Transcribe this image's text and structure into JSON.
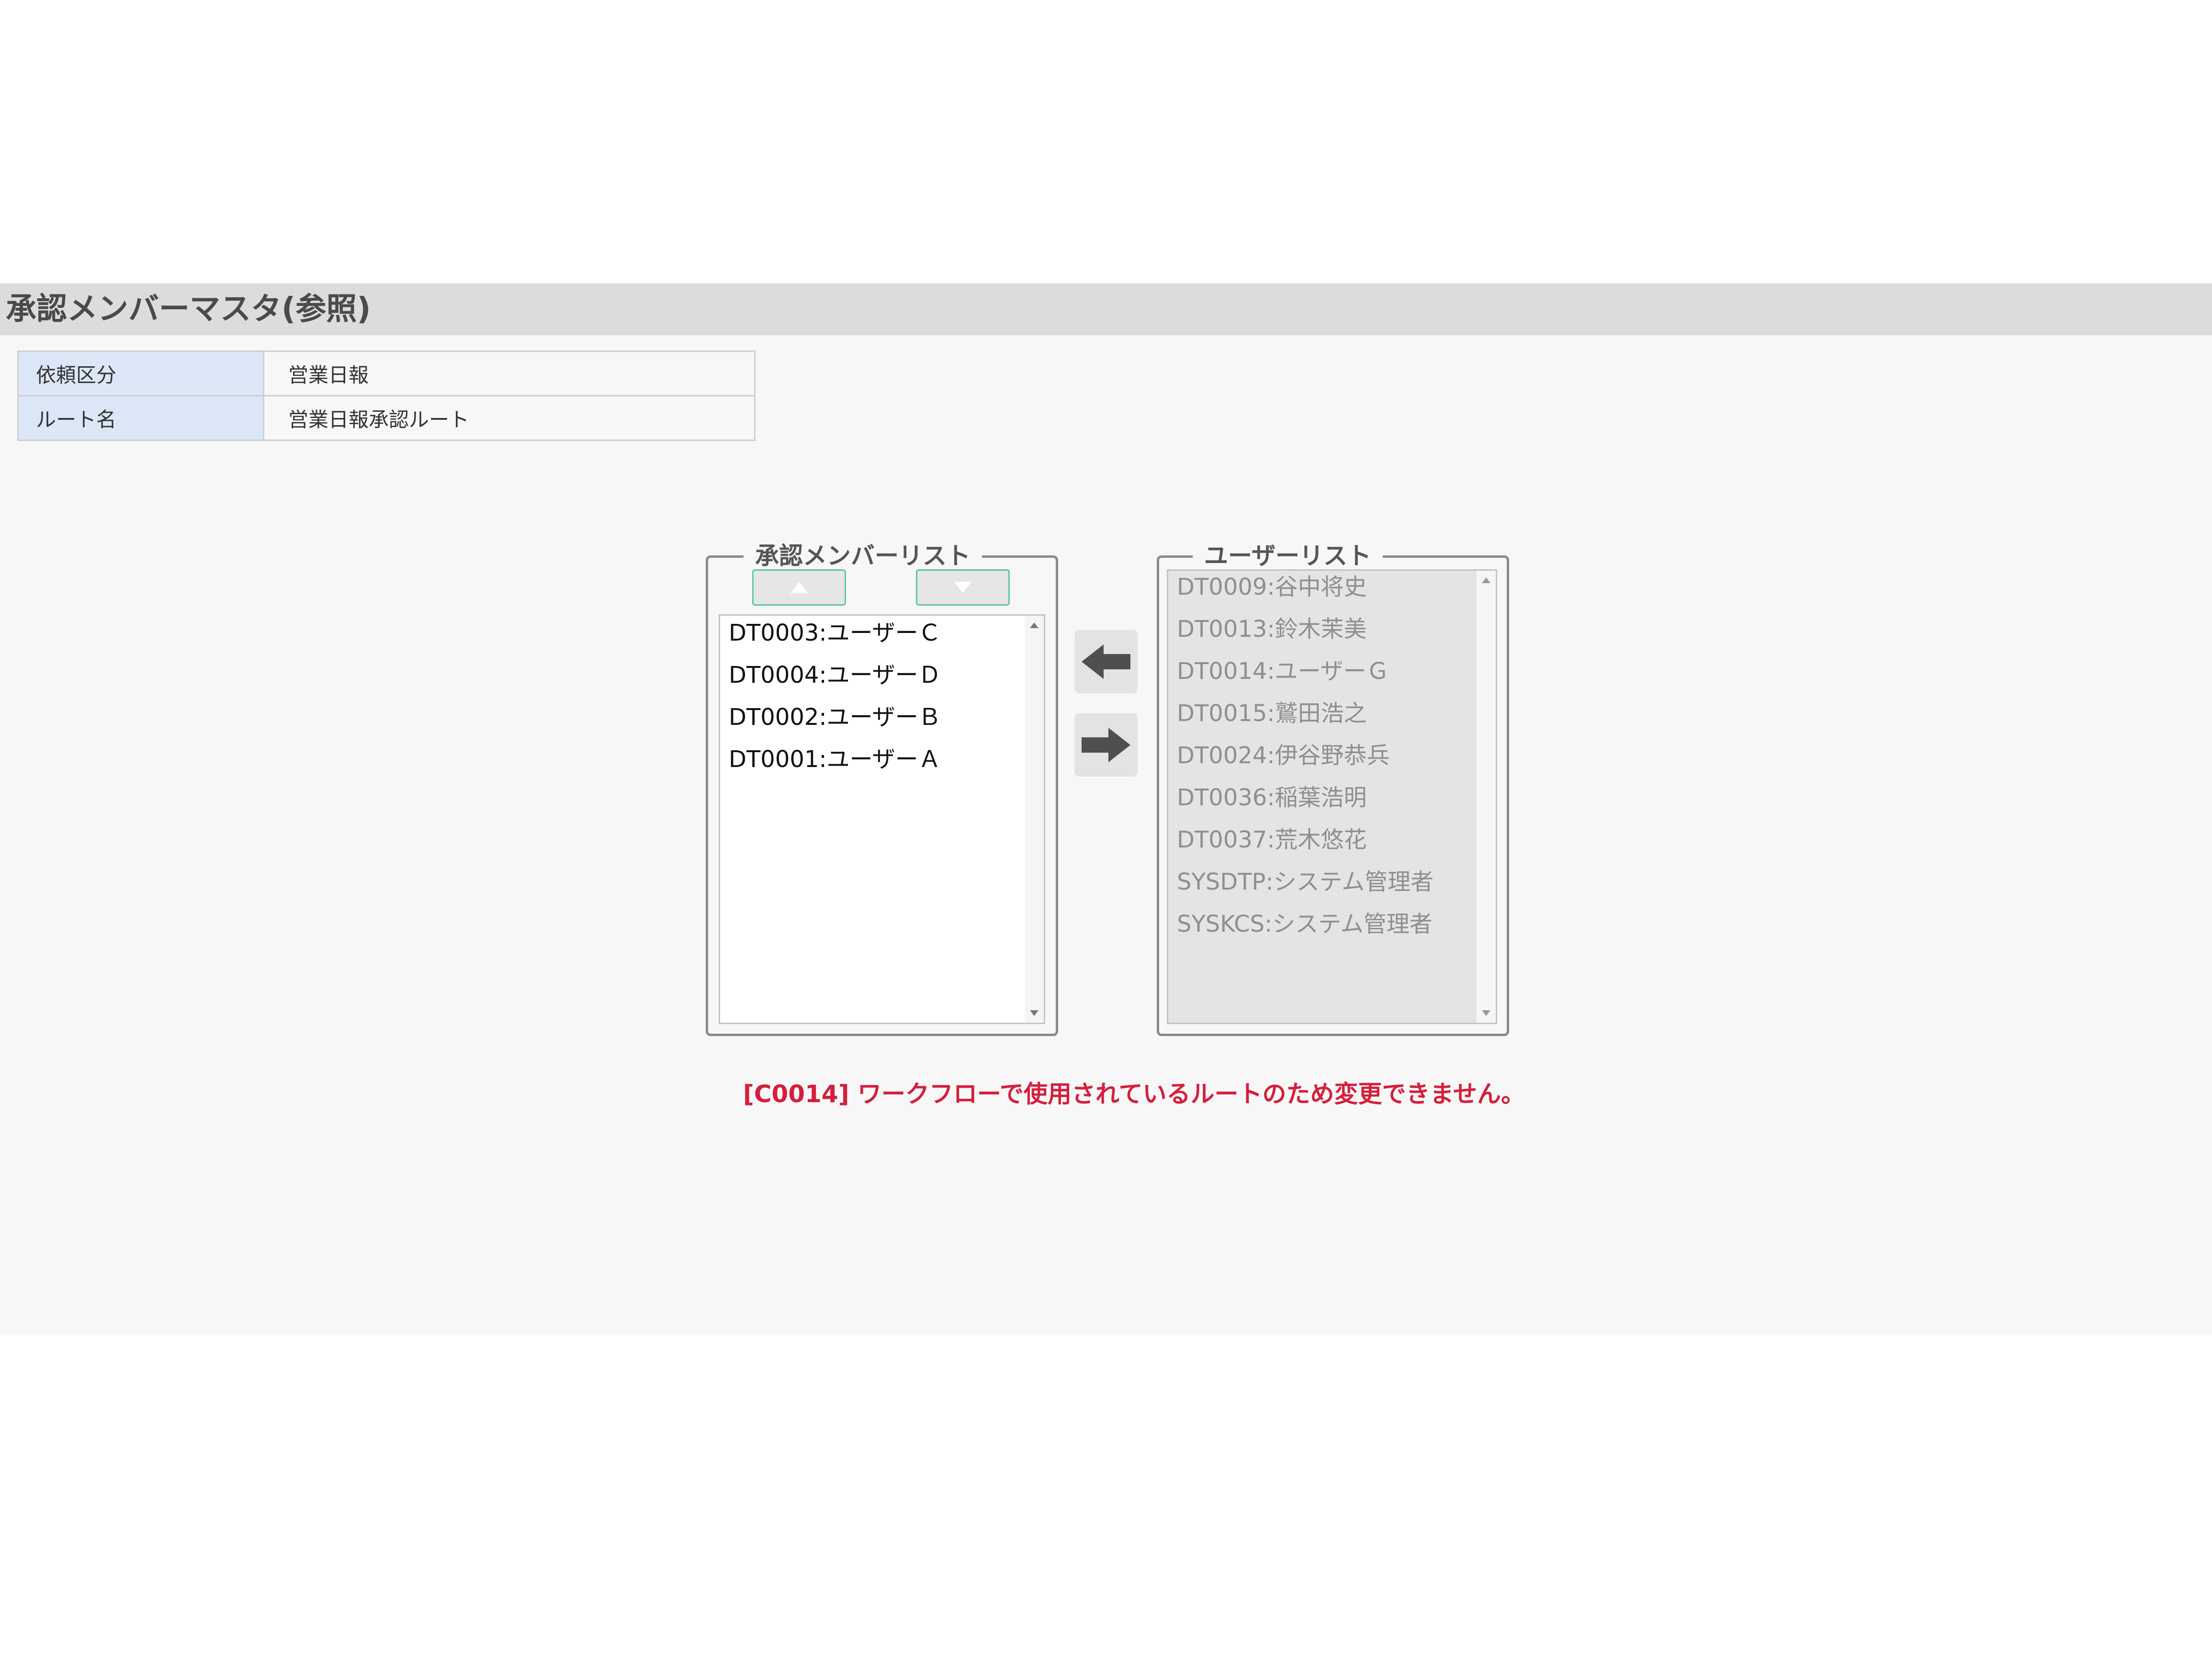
{
  "page_title": "承認メンバーマスタ(参照)",
  "info_table": {
    "rows": [
      {
        "label": "依頼区分",
        "value": "営業日報"
      },
      {
        "label": "ルート名",
        "value": "営業日報承認ルート"
      }
    ]
  },
  "approval_member_list": {
    "legend": "承認メンバーリスト",
    "move_up_icon": "triangle-up-icon",
    "move_down_icon": "triangle-down-icon",
    "items": [
      "DT0003:ユーザーＣ",
      "DT0004:ユーザーＤ",
      "DT0002:ユーザーＢ",
      "DT0001:ユーザーＡ"
    ]
  },
  "transfer_buttons": {
    "add_icon": "arrow-left-icon",
    "remove_icon": "arrow-right-icon"
  },
  "user_list": {
    "legend": "ユーザーリスト",
    "disabled": true,
    "items": [
      "DT0009:谷中将史",
      "DT0013:鈴木茉美",
      "DT0014:ユーザーＧ",
      "DT0015:鷲田浩之",
      "DT0024:伊谷野恭兵",
      "DT0036:稲葉浩明",
      "DT0037:荒木悠花",
      "SYSDTP:システム管理者",
      "SYSKCS:システム管理者"
    ]
  },
  "error_message": "[C0014] ワークフローで使用されているルートのため変更できません。",
  "colors": {
    "title_bar": "#dcdcdc",
    "label_cell": "#dbe7f7",
    "error": "#d41f3c",
    "button_border": "#5cc7a0"
  }
}
